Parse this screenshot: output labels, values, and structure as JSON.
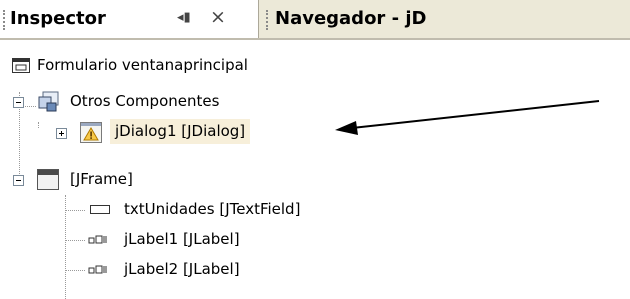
{
  "tabs": [
    {
      "label": "Inspector",
      "minimize_glyph": "◂▮",
      "close_glyph": "×"
    },
    {
      "label": "Navegador - jD"
    }
  ],
  "tree": {
    "root": {
      "label": "Formulario ventanaprincipal",
      "icon": "form-icon"
    },
    "other_components": {
      "label": "Otros Componentes",
      "icon": "components-icon",
      "children": [
        {
          "label": "jDialog1 [JDialog]",
          "icon": "dialog-warning-icon",
          "selected": true
        }
      ]
    },
    "jframe": {
      "label": "[JFrame]",
      "icon": "frame-icon",
      "children": [
        {
          "label": "txtUnidades [JTextField]",
          "icon": "textfield-icon"
        },
        {
          "label": "jLabel1 [JLabel]",
          "icon": "label-icon"
        },
        {
          "label": "jLabel2 [JLabel]",
          "icon": "label-icon"
        }
      ]
    }
  },
  "annotation": {
    "icon": "pointer-arrow-icon",
    "target": "jDialog1 [JDialog]"
  }
}
